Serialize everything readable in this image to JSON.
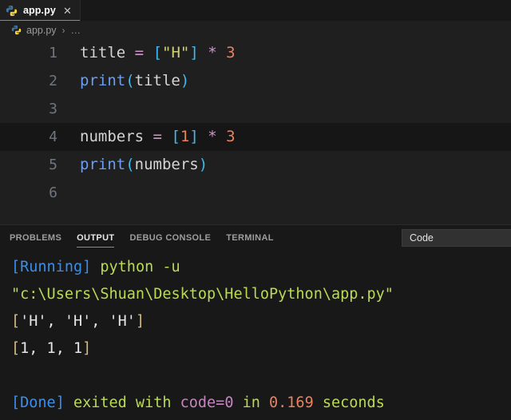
{
  "window": {
    "tab": {
      "label": "app.py",
      "icon": "python-file-icon",
      "close_icon": "close-icon",
      "active": true,
      "accent_color": "#4ba6a0"
    }
  },
  "breadcrumb": {
    "icon": "python-file-icon",
    "file": "app.py",
    "separator": "›",
    "dots": "…"
  },
  "editor": {
    "language": "python",
    "active_line": 4,
    "lines": [
      {
        "number": "1",
        "tokens": [
          {
            "text": "title",
            "color": "#d4d4d4",
            "role": "variable"
          },
          {
            "text": " ",
            "color": "#d4d4d4",
            "role": "space"
          },
          {
            "text": "=",
            "color": "#d196c9",
            "role": "operator"
          },
          {
            "text": " ",
            "color": "#d4d4d4",
            "role": "space"
          },
          {
            "text": "[",
            "color": "#41b9ec",
            "role": "bracket"
          },
          {
            "text": "\"H\"",
            "color": "#cfd178",
            "role": "string"
          },
          {
            "text": "]",
            "color": "#41b9ec",
            "role": "bracket"
          },
          {
            "text": " ",
            "color": "#d4d4d4",
            "role": "space"
          },
          {
            "text": "*",
            "color": "#d196c9",
            "role": "operator"
          },
          {
            "text": " ",
            "color": "#d4d4d4",
            "role": "space"
          },
          {
            "text": "3",
            "color": "#e8825f",
            "role": "number"
          }
        ]
      },
      {
        "number": "2",
        "tokens": [
          {
            "text": "print",
            "color": "#6b9ef3",
            "role": "function"
          },
          {
            "text": "(",
            "color": "#41b9ec",
            "role": "bracket"
          },
          {
            "text": "title",
            "color": "#d4d4d4",
            "role": "variable"
          },
          {
            "text": ")",
            "color": "#41b9ec",
            "role": "bracket"
          }
        ]
      },
      {
        "number": "3",
        "tokens": []
      },
      {
        "number": "4",
        "tokens": [
          {
            "text": "numbers",
            "color": "#d4d4d4",
            "role": "variable"
          },
          {
            "text": " ",
            "color": "#d4d4d4",
            "role": "space"
          },
          {
            "text": "=",
            "color": "#d196c9",
            "role": "operator"
          },
          {
            "text": " ",
            "color": "#d4d4d4",
            "role": "space"
          },
          {
            "text": "[",
            "color": "#41b9ec",
            "role": "bracket"
          },
          {
            "text": "1",
            "color": "#e8825f",
            "role": "number"
          },
          {
            "text": "]",
            "color": "#41b9ec",
            "role": "bracket"
          },
          {
            "text": " ",
            "color": "#d4d4d4",
            "role": "space"
          },
          {
            "text": "*",
            "color": "#d196c9",
            "role": "operator"
          },
          {
            "text": " ",
            "color": "#d4d4d4",
            "role": "space"
          },
          {
            "text": "3",
            "color": "#e8825f",
            "role": "number"
          }
        ]
      },
      {
        "number": "5",
        "tokens": [
          {
            "text": "print",
            "color": "#6b9ef3",
            "role": "function"
          },
          {
            "text": "(",
            "color": "#41b9ec",
            "role": "bracket"
          },
          {
            "text": "numbers",
            "color": "#d4d4d4",
            "role": "variable"
          },
          {
            "text": ")",
            "color": "#41b9ec",
            "role": "bracket"
          }
        ]
      },
      {
        "number": "6",
        "tokens": []
      }
    ]
  },
  "panel": {
    "tabs": [
      {
        "label": "PROBLEMS",
        "active": false
      },
      {
        "label": "OUTPUT",
        "active": true
      },
      {
        "label": "DEBUG CONSOLE",
        "active": false
      },
      {
        "label": "TERMINAL",
        "active": false
      }
    ],
    "channel_select": {
      "value": "Code"
    },
    "output_lines": [
      {
        "segments": [
          {
            "text": "[Running]",
            "color": "#3b8eea"
          },
          {
            "text": " ",
            "color": "#cccccc"
          },
          {
            "text": "python -u",
            "color": "#bada55"
          }
        ]
      },
      {
        "segments": [
          {
            "text": "\"c:\\Users\\Shuan\\Desktop\\HelloPython\\app.py\"",
            "color": "#bada55"
          }
        ]
      },
      {
        "segments": [
          {
            "text": "[",
            "color": "#d7ba7d"
          },
          {
            "text": "'H', 'H', 'H'",
            "color": "#e6e6e6"
          },
          {
            "text": "]",
            "color": "#d7ba7d"
          }
        ]
      },
      {
        "segments": [
          {
            "text": "[",
            "color": "#d7ba7d"
          },
          {
            "text": "1, 1, 1",
            "color": "#e6e6e6"
          },
          {
            "text": "]",
            "color": "#d7ba7d"
          }
        ]
      },
      {
        "segments": []
      },
      {
        "segments": [
          {
            "text": "[Done]",
            "color": "#3b8eea"
          },
          {
            "text": " ",
            "color": "#cccccc"
          },
          {
            "text": "exited with ",
            "color": "#bada55"
          },
          {
            "text": "code=0",
            "color": "#c586c0"
          },
          {
            "text": " in ",
            "color": "#bada55"
          },
          {
            "text": "0.169",
            "color": "#e8825f"
          },
          {
            "text": " seconds",
            "color": "#bada55"
          }
        ]
      }
    ]
  }
}
